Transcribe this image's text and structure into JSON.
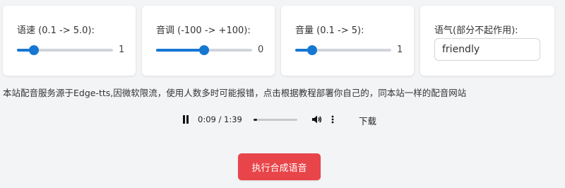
{
  "settings": {
    "rate": {
      "label": "语速 (0.1 -> 5.0):",
      "value": "1",
      "level": 0.18
    },
    "pitch": {
      "label": "音调 (-100 -> +100):",
      "value": "0",
      "level": 0.5
    },
    "volume": {
      "label": "音量 (0.1 -> 5):",
      "value": "1",
      "level": 0.18
    },
    "style": {
      "label": "语气(部分不起作用):",
      "value": "friendly"
    }
  },
  "notice": "本站配音服务源于Edge-tts,因微软限流，使用人数多时可能报错，点击根据教程部署你自己的，同本站一样的配音网站",
  "player": {
    "time": "0:09 / 1:39",
    "progress": 0.09,
    "play_state_icon": "pause-icon",
    "volume_icon": "volume-icon",
    "menu_icon": "more-vertical-icon"
  },
  "download_label": "下载",
  "synthesize_label": "执行合成语音",
  "colors": {
    "accent": "#1677d2",
    "button": "#e8454a",
    "page_bg": "#f3f4f6"
  }
}
